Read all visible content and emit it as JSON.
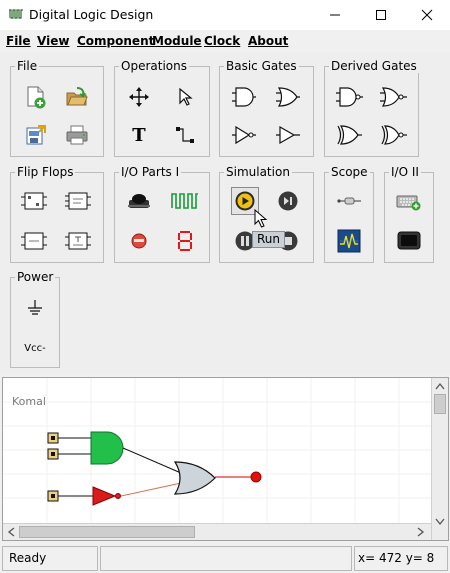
{
  "window": {
    "title": "Digital Logic Design",
    "controls": [
      "minimize",
      "maximize",
      "close"
    ]
  },
  "menu": {
    "items": [
      "File",
      "View",
      "Component",
      "Module",
      "Clock",
      "About"
    ]
  },
  "toolbar": {
    "groups": {
      "file": {
        "title": "File"
      },
      "operations": {
        "title": "Operations",
        "text_tool_glyph": "T"
      },
      "basic_gates": {
        "title": "Basic Gates"
      },
      "derived_gates": {
        "title": "Derived Gates"
      },
      "flip_flops": {
        "title": "Flip Flops"
      },
      "io_parts_1": {
        "title": "I/O Parts I"
      },
      "simulation": {
        "title": "Simulation",
        "tooltip": "Run"
      },
      "scope": {
        "title": "Scope"
      },
      "io_2": {
        "title": "I/O II"
      },
      "power": {
        "title": "Power",
        "vcc_label": "Vcc-"
      }
    }
  },
  "canvas": {
    "label": "Komal",
    "wire_colors": {
      "input": "#000000",
      "output": "#d40000",
      "inverter": "#d87050"
    },
    "gate_colors": {
      "and": "#22c04a",
      "not": "#d81c1c",
      "or": "#cdd4da",
      "led": "#e01010"
    }
  },
  "status": {
    "message": "Ready",
    "section": "",
    "coordinates": "x= 472  y= 8"
  }
}
